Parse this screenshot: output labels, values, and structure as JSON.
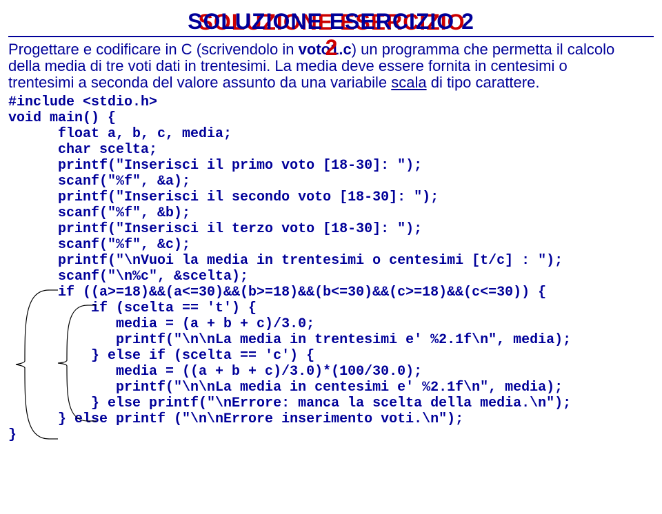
{
  "title": "SOLUZIONE ESERCIZIO 2",
  "intro_line1_a": "Progettare e codificare in C (scrivendolo in ",
  "intro_line1_b": "voto1.c",
  "intro_line1_c": ") un programma che permetta il calcolo",
  "intro_line2": "della media di tre voti dati in trentesimi. La media deve essere fornita in centesimi o",
  "intro_line3_a": "trentesimi a seconda del valore assunto da una variabile ",
  "intro_line3_b": "scala",
  "intro_line3_c": " di tipo carattere.",
  "code": {
    "l01": "#include <stdio.h>",
    "l02": "void main() {",
    "l03": "      float a, b, c, media;",
    "l04": "      char scelta;",
    "l05": "      printf(\"Inserisci il primo voto [18-30]: \");",
    "l06": "      scanf(\"%f\", &a);",
    "l07": "      printf(\"Inserisci il secondo voto [18-30]: \");",
    "l08": "      scanf(\"%f\", &b);",
    "l09": "      printf(\"Inserisci il terzo voto [18-30]: \");",
    "l10": "      scanf(\"%f\", &c);",
    "l11": "      printf(\"\\nVuoi la media in trentesimi o centesimi [t/c] : \");",
    "l12": "      scanf(\"\\n%c\", &scelta);",
    "l13": "      if ((a>=18)&&(a<=30)&&(b>=18)&&(b<=30)&&(c>=18)&&(c<=30)) {",
    "l14": "          if (scelta == 't') {",
    "l15": "             media = (a + b + c)/3.0;",
    "l16": "             printf(\"\\n\\nLa media in trentesimi e' %2.1f\\n\", media);",
    "l17": "          } else if (scelta == 'c') {",
    "l18": "             media = ((a + b + c)/3.0)*(100/30.0);",
    "l19": "             printf(\"\\n\\nLa media in centesimi e' %2.1f\\n\", media);",
    "l20": "          } else printf(\"\\nErrore: manca la scelta della media.\\n\");",
    "l21": "      } else printf (\"\\n\\nErrore inserimento voti.\\n\");",
    "l22": "}"
  }
}
